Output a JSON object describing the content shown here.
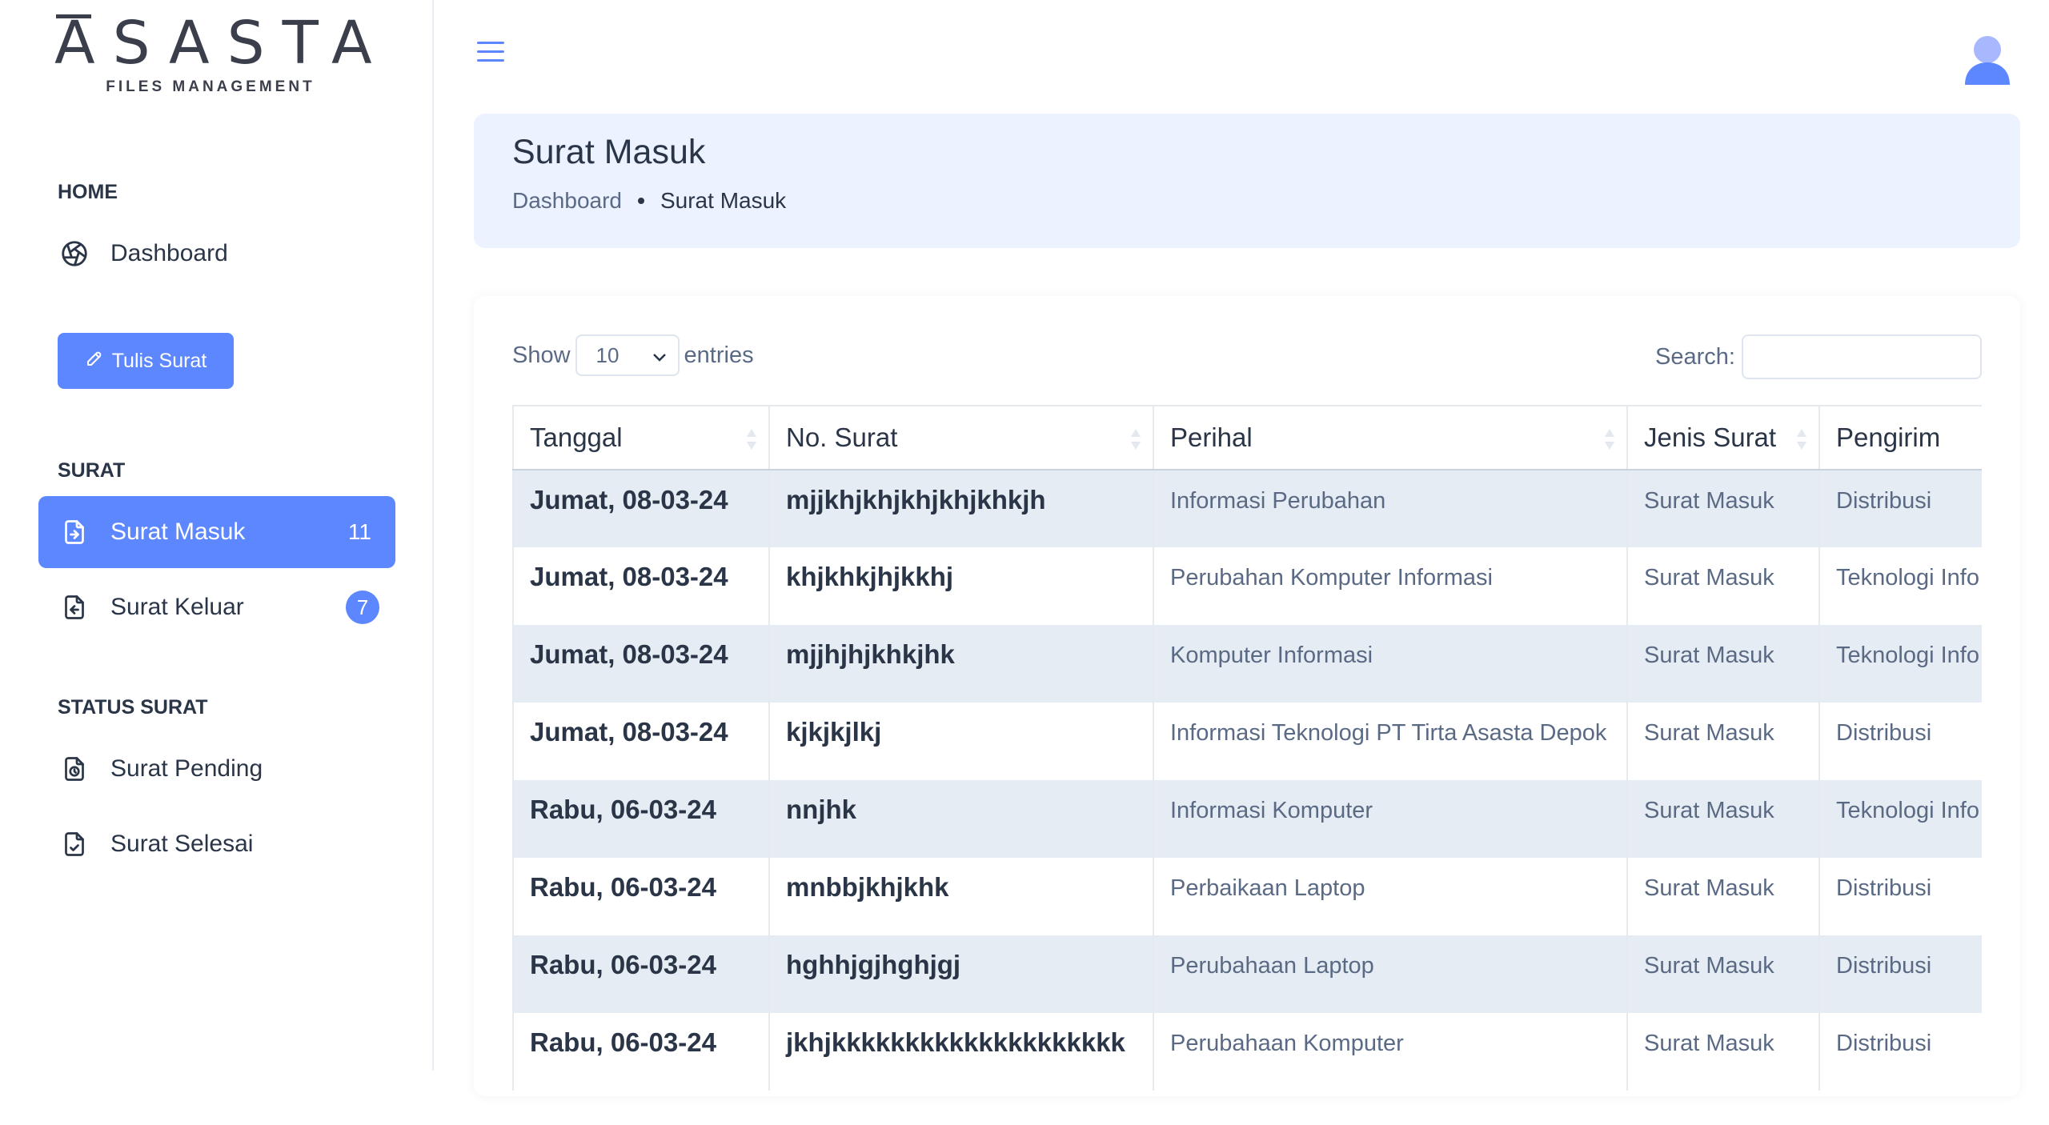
{
  "logo": {
    "word": "ASASTA",
    "sub": "FILES MANAGEMENT"
  },
  "sidebar": {
    "caption_home": "HOME",
    "dashboard": "Dashboard",
    "write_button": "Tulis Surat",
    "caption_surat": "SURAT",
    "surat_masuk": {
      "label": "Surat Masuk",
      "count": "11"
    },
    "surat_keluar": {
      "label": "Surat Keluar",
      "count": "7"
    },
    "caption_status": "STATUS SURAT",
    "pending": "Surat Pending",
    "selesai": "Surat Selesai"
  },
  "banner": {
    "title": "Surat Masuk",
    "crumb_1": "Dashboard",
    "crumb_2": "Surat Masuk"
  },
  "table_controls": {
    "show": "Show",
    "entries_value": "10",
    "entries": "entries",
    "search_label": "Search:"
  },
  "table": {
    "headers": [
      "Tanggal",
      "No. Surat",
      "Perihal",
      "Jenis Surat",
      "Pengirim"
    ],
    "rows": [
      [
        "Jumat, 08-03-24",
        "mjjkhjkhjkhjkhjkhkjh",
        "Informasi Perubahan",
        "Surat Masuk",
        "Distribusi"
      ],
      [
        "Jumat, 08-03-24",
        "khjkhkjhjkkhj",
        "Perubahan Komputer Informasi",
        "Surat Masuk",
        "Teknologi Info"
      ],
      [
        "Jumat, 08-03-24",
        "mjjhjhjkhkjhk",
        "Komputer Informasi",
        "Surat Masuk",
        "Teknologi Info"
      ],
      [
        "Jumat, 08-03-24",
        "kjkjkjlkj",
        "Informasi Teknologi PT Tirta Asasta Depok",
        "Surat Masuk",
        "Distribusi"
      ],
      [
        "Rabu, 06-03-24",
        "nnjhk",
        "Informasi Komputer",
        "Surat Masuk",
        "Teknologi Info"
      ],
      [
        "Rabu, 06-03-24",
        "mnbbjkhjkhk",
        "Perbaikaan Laptop",
        "Surat Masuk",
        "Distribusi"
      ],
      [
        "Rabu, 06-03-24",
        "hghhjgjhghjgj",
        "Perubahaan Laptop",
        "Surat Masuk",
        "Distribusi"
      ],
      [
        "Rabu, 06-03-24",
        "jkhjkkkkkkkkkkkkkkkkkkkk",
        "Perubahaan Komputer",
        "Surat Masuk",
        "Distribusi"
      ]
    ]
  },
  "colors": {
    "accent": "#5d87ff",
    "banner_bg": "#ecf2ff",
    "row_stripe": "#e6ecf3"
  }
}
